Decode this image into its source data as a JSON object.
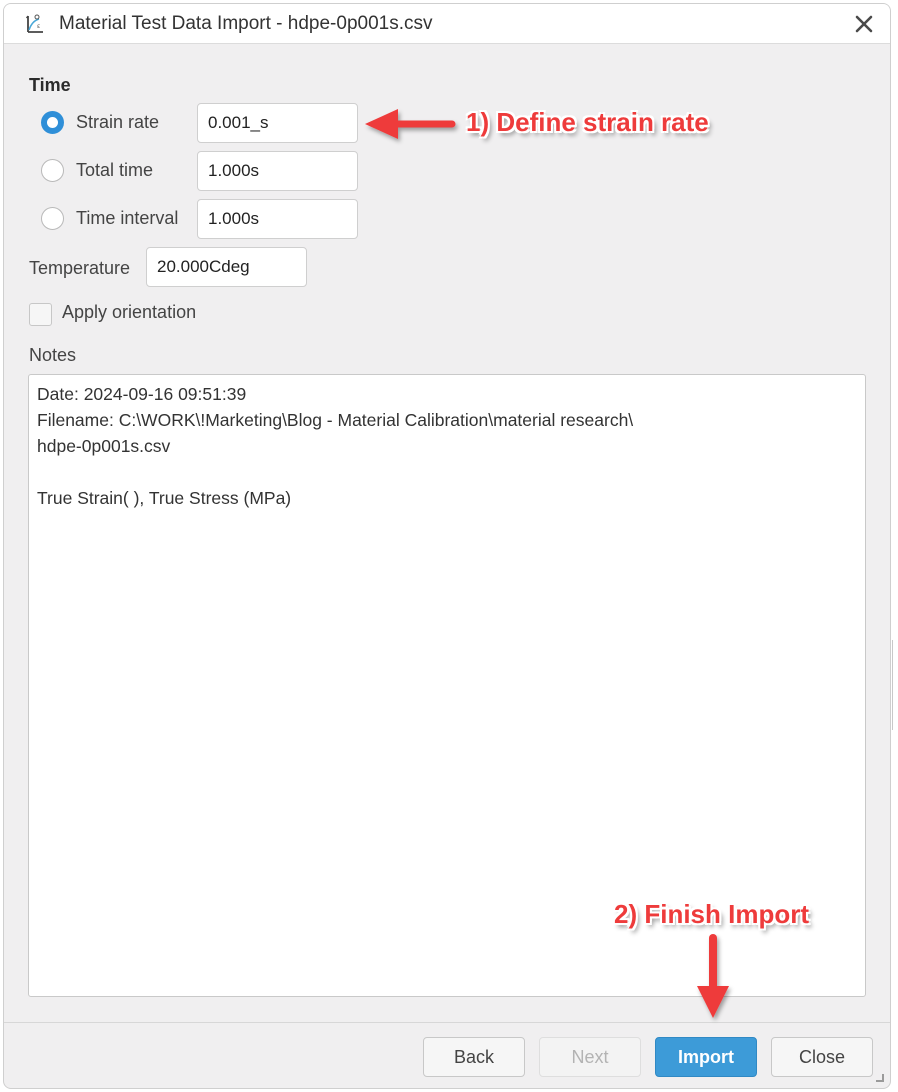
{
  "window": {
    "title": "Material Test Data Import - hdpe-0p001s.csv",
    "app_icon": "stress-strain-curve-icon",
    "close_icon": "close-icon"
  },
  "time_section": {
    "heading": "Time",
    "options": [
      {
        "label": "Strain rate",
        "value": "0.001_s",
        "selected": true
      },
      {
        "label": "Total time",
        "value": "1.000s",
        "selected": false
      },
      {
        "label": "Time interval",
        "value": "1.000s",
        "selected": false
      }
    ]
  },
  "temperature": {
    "label": "Temperature",
    "value": "20.000Cdeg"
  },
  "apply_orientation": {
    "label": "Apply orientation",
    "checked": false
  },
  "notes": {
    "label": "Notes",
    "content": "Date: 2024-09-16 09:51:39\nFilename: C:\\WORK\\!Marketing\\Blog - Material Calibration\\material research\\\nhdpe-0p001s.csv\n\nTrue Strain( ), True Stress (MPa)"
  },
  "footer": {
    "back_label": "Back",
    "next_label": "Next",
    "next_enabled": false,
    "import_label": "Import",
    "close_label": "Close"
  },
  "annotations": {
    "step1": "1) Define strain rate",
    "step2": "2) Finish Import",
    "color": "#ee3b3b"
  },
  "colors": {
    "accent": "#3d9bd8",
    "radio_selected": "#2f8fd8",
    "dialog_bg": "#f0eff0"
  }
}
